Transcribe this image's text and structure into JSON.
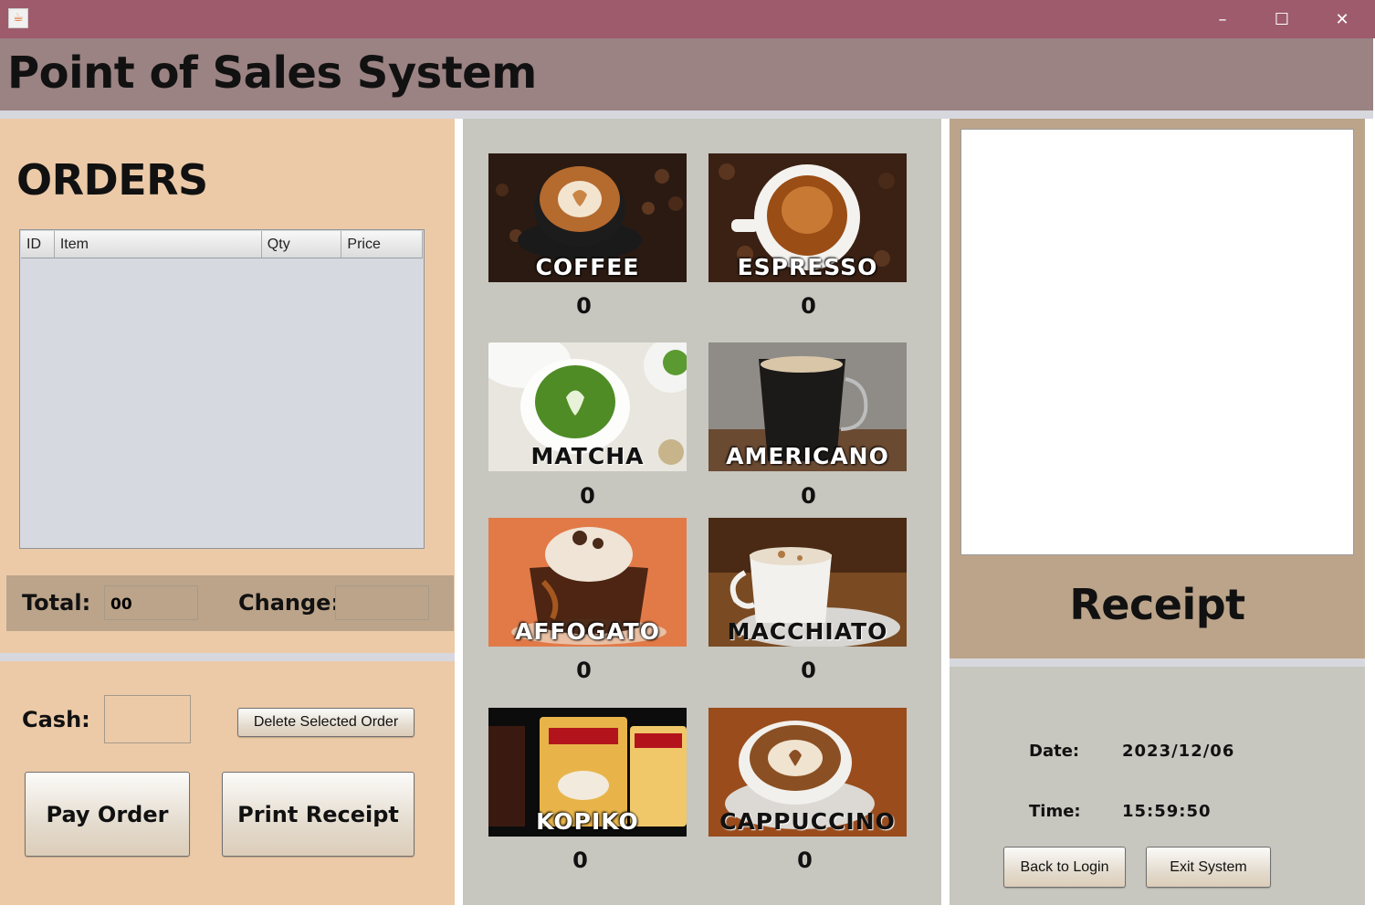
{
  "window": {
    "minimize": "–",
    "maximize": "☐",
    "close": "✕"
  },
  "header": {
    "title": "Point of Sales System"
  },
  "orders": {
    "title": "ORDERS",
    "columns": [
      "ID",
      "Item",
      "Qty",
      "Price"
    ],
    "rows": [],
    "total_label": "Total:",
    "total_value": "00",
    "change_label": "Change:",
    "change_value": ""
  },
  "payment": {
    "cash_label": "Cash:",
    "cash_value": "",
    "delete_button": "Delete Selected Order",
    "pay_button": "Pay Order",
    "print_button": "Print Receipt"
  },
  "menu": {
    "items": [
      {
        "label": "COFFEE",
        "qty": "0"
      },
      {
        "label": "ESPRESSO",
        "qty": "0"
      },
      {
        "label": "MATCHA",
        "qty": "0"
      },
      {
        "label": "AMERICANO",
        "qty": "0"
      },
      {
        "label": "AFFOGATO",
        "qty": "0"
      },
      {
        "label": "MACCHIATO",
        "qty": "0"
      },
      {
        "label": "KOPIKO",
        "qty": "0"
      },
      {
        "label": "CAPPUCCINO",
        "qty": "0"
      }
    ]
  },
  "receipt": {
    "label": "Receipt",
    "content": ""
  },
  "info": {
    "date_label": "Date:",
    "date_value": "2023/12/06",
    "time_label": "Time:",
    "time_value": "15:59:50",
    "back_button": "Back to Login",
    "exit_button": "Exit System"
  },
  "colors": {
    "titlebar": "#9e5b6c",
    "header": "#9b8283",
    "panel_peach": "#eccaa8",
    "panel_tan": "#bba48a",
    "panel_gray": "#c7c6bf"
  }
}
